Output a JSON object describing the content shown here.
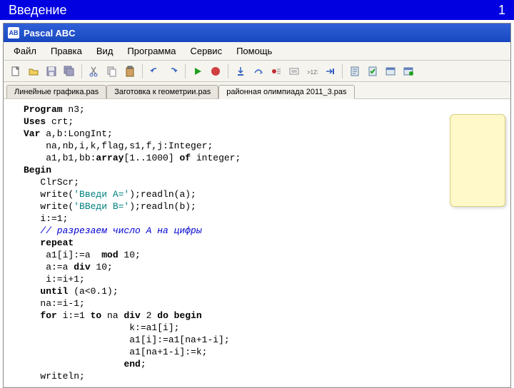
{
  "slide": {
    "title": "Введение",
    "number": "1"
  },
  "window": {
    "title": "Pascal ABC",
    "icon_text": "AB"
  },
  "menu": [
    "Файл",
    "Правка",
    "Вид",
    "Программа",
    "Сервис",
    "Помощь"
  ],
  "tabs": [
    {
      "label": "Линейные графика.pas",
      "active": false
    },
    {
      "label": "Заготовка к геометрии.pas",
      "active": false
    },
    {
      "label": "районная олимпиада 2011_3.pas",
      "active": true
    }
  ],
  "code": {
    "l1_kw": "Program",
    "l1_r": " n3;",
    "l2_kw": "Uses",
    "l2_r": " crt;",
    "l3_kw": "Var",
    "l3_r": " a,b:LongInt;",
    "l4": "    na,nb,i,k,flag,s1,f,j:Integer;",
    "l5_a": "    a1,b1,bb:",
    "l5_kw1": "array",
    "l5_b": "[1..1000] ",
    "l5_kw2": "of",
    "l5_c": " integer;",
    "l6_kw": "Begin",
    "l7": "   ClrScr;",
    "l8_a": "   write(",
    "l8_s": "'Введи A='",
    "l8_b": ");readln(a);",
    "l9_a": "   write(",
    "l9_s": "'ВВеди B='",
    "l9_b": ");readln(b);",
    "l10": "   i:=1;",
    "l11_cm": "   // разрезаем число А на цифры",
    "l12_sp": "   ",
    "l12_kw": "repeat",
    "l13_a": "    a1[i]:=a  ",
    "l13_kw": "mod",
    "l13_b": " 10;",
    "l14_a": "    a:=a ",
    "l14_kw": "div",
    "l14_b": " 10;",
    "l15": "    i:=i+1;",
    "l16_sp": "   ",
    "l16_kw": "until",
    "l16_r": " (a<0.1);",
    "l17": "   na:=i-1;",
    "l18_sp": "   ",
    "l18_kw1": "for",
    "l18_a": " i:=1 ",
    "l18_kw2": "to",
    "l18_b": " na ",
    "l18_kw3": "div",
    "l18_c": " 2 ",
    "l18_kw4": "do begin",
    "l19": "                   k:=a1[i];",
    "l20": "                   a1[i]:=a1[na+1-i];",
    "l21": "                   a1[na+1-i]:=k;",
    "l22_sp": "                  ",
    "l22_kw": "end",
    "l22_r": ";",
    "l23": "   writeln;"
  }
}
